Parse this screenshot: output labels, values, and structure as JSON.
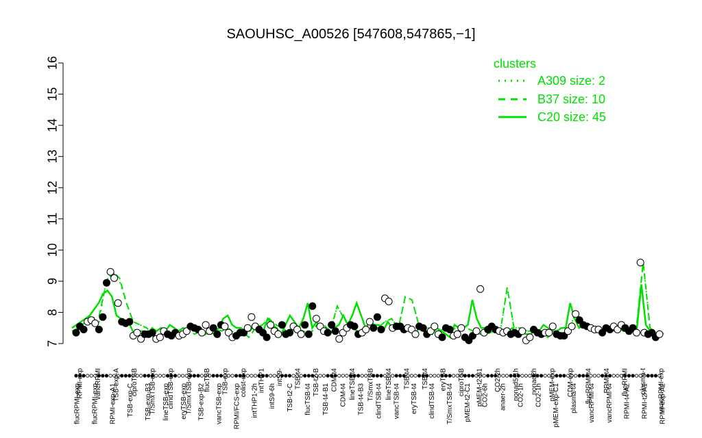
{
  "chart_data": {
    "type": "line",
    "title": "SAOUHSC_A00526 [547608,547865,−1]",
    "xlabel": "",
    "ylabel": "",
    "ylim": [
      7,
      16
    ],
    "yticks": [
      7,
      8,
      9,
      10,
      11,
      12,
      13,
      14,
      15,
      16
    ],
    "grid": false,
    "legend": {
      "title": "clusters",
      "position": "top-right",
      "entries": [
        {
          "label": "A309 size: 2",
          "style": "dotted"
        },
        {
          "label": "B37 size: 10",
          "style": "dashed"
        },
        {
          "label": "C20 size: 45",
          "style": "solid"
        }
      ]
    },
    "x_tick_labels": [
      "flucRPMI-exp",
      "flucRPMI-exp",
      "RPMI-exp-A1",
      "TSB-exp-C",
      "TSB-exp-B3",
      "lineTSB-exp",
      "eryTSB-exp",
      "TSB-exp-B2",
      "vancTSB-exp",
      "RPMI/FCS-exp",
      "intTHP1-2h",
      "intS9-6h",
      "TSB-t2-C",
      "flucTSB-t4",
      "TSB-t4-B1",
      "CDM-t4",
      "TSB-t4-B3",
      "clindTSB-t4",
      "vancTSB-t4",
      "eryTSB-t4",
      "clindTSB-t4",
      "T/SmxTSB-t4",
      "pMEM-t2-C1",
      "CO2-6h",
      "anaer-2h",
      "CO2-1h",
      "CO2-1h",
      "pMEM-exp-C1",
      "plasma-t4",
      "vancRPMI-t4",
      "vancRPMI-t4",
      "RPMI-t4-A2",
      "RPMI-t2-A1",
      "RPMI-exp-A2"
    ],
    "upper_labels": [
      "RPMI-exp",
      "vancRPMI",
      "TSB-exp-A",
      "ciproTSB",
      "T/SmxTSB-exp",
      "clindTSB-exp",
      "T/SmxTSB-exp",
      "flucTSB",
      "TSB-exp",
      "colist-exp",
      "intTHP1",
      "intS9-",
      "TSB-t4",
      "TSB-t2-B",
      "CDM-t4",
      "lineTSB-t4",
      "T/SmxTSB",
      "lineTSB-t4",
      "TSB-t4",
      "TSB-t4",
      "eryTSB",
      "ciproTSB",
      "pMEM-t2-B1",
      "CO2-2h",
      "nonad5-1h",
      "nonad2h",
      "pMEM-exp",
      "CDM-exp",
      "flucRPMI-t4",
      "RPMI-t4",
      "flucRPMI",
      "plasma-t",
      "vancRPMI-exp"
    ],
    "series": [
      {
        "style": "solid",
        "values": [
          7.5,
          7.6,
          7.7,
          7.8,
          7.9,
          8.1,
          8.3,
          8.6,
          8.7,
          8.5,
          7.9,
          7.8,
          7.7,
          7.6,
          7.3,
          7.4,
          7.4,
          7.3,
          7.5,
          7.4,
          7.5,
          7.4,
          7.6,
          7.5,
          7.4,
          7.5,
          7.4,
          7.6,
          7.5,
          7.5,
          7.3,
          7.4,
          7.3,
          7.5,
          7.8,
          7.9,
          7.6,
          7.5,
          7.5,
          7.4,
          7.4,
          7.6,
          7.5,
          7.4,
          7.8,
          7.6,
          7.5,
          7.3,
          7.6,
          7.9,
          7.7,
          7.5,
          7.8,
          8.3,
          7.5,
          7.7,
          7.4,
          7.5,
          7.3,
          7.5,
          7.6,
          7.9,
          7.6,
          7.9,
          8.3,
          7.9,
          7.5,
          7.7,
          7.6,
          7.6,
          7.4,
          7.7,
          7.5,
          7.5,
          7.6,
          7.4,
          7.5,
          7.3,
          7.5,
          7.4,
          7.4,
          7.3,
          7.5,
          7.4,
          7.3,
          7.2,
          7.6,
          7.5,
          7.5,
          7.6,
          8.4,
          7.8,
          7.5,
          7.5,
          7.6,
          7.5,
          7.4,
          7.4,
          7.4,
          7.5,
          7.3,
          7.4,
          7.3,
          7.3,
          7.4,
          7.4,
          7.6,
          7.5,
          7.4,
          7.4,
          7.5,
          7.5,
          8.3,
          7.8,
          7.5,
          7.6,
          7.5,
          7.5,
          7.4,
          7.4,
          7.5,
          7.5,
          7.4,
          7.5,
          7.4,
          7.4,
          7.5,
          7.5,
          8.9,
          7.6,
          7.4,
          7.3,
          7.4,
          7.3
        ]
      },
      {
        "style": "dashed",
        "values": [
          7.4,
          7.5,
          7.7,
          7.8,
          7.9,
          8.9,
          9.3,
          9.1,
          8.3,
          7.7,
          7.6,
          7.5,
          7.2,
          7.3,
          7.3,
          7.2,
          7.3,
          7.5,
          7.3,
          7.4,
          7.3,
          7.5,
          7.4,
          7.5,
          7.3,
          7.4,
          7.2,
          7.5,
          7.6,
          7.8,
          7.6,
          7.5,
          7.3,
          7.5,
          7.4,
          7.3,
          7.6,
          7.6,
          7.4,
          8.2,
          7.8,
          7.5,
          7.4,
          7.5,
          7.6,
          7.5,
          7.7,
          7.8,
          7.5,
          8.5,
          8.4,
          7.6,
          7.5,
          7.5,
          7.4,
          7.5,
          7.5,
          7.4,
          7.5,
          7.4,
          7.3,
          7.3,
          7.4,
          7.4,
          8.8,
          7.5,
          7.5,
          7.4,
          7.4,
          7.3,
          7.2,
          7.4,
          7.3,
          7.3,
          8.0,
          7.7,
          7.5,
          7.5,
          7.5,
          7.4,
          7.5,
          7.5,
          7.4,
          7.5,
          9.6,
          7.5,
          7.3,
          7.3
        ]
      },
      {
        "style": "dotted",
        "values": [
          7.4,
          7.5,
          7.8,
          7.8,
          7.7,
          9.0,
          9.3,
          9.0,
          8.3,
          7.7,
          7.6,
          7.5,
          7.2,
          7.3,
          7.3,
          7.2,
          7.3,
          7.5,
          7.3,
          7.4,
          7.3,
          7.5,
          7.4,
          7.5,
          7.3,
          7.4,
          7.2,
          7.5,
          7.6,
          7.8,
          7.6,
          7.5,
          7.3,
          7.5,
          7.4,
          7.3,
          7.6,
          7.6,
          7.4,
          8.2,
          7.8,
          7.5,
          7.4,
          7.5,
          7.6,
          7.5,
          7.7,
          7.8,
          7.5,
          8.5,
          8.4,
          7.6,
          7.5,
          7.5,
          7.4,
          7.5,
          7.5,
          7.4,
          7.5,
          7.4,
          7.3,
          7.3,
          7.4,
          7.4,
          8.8,
          7.5,
          7.5,
          7.4,
          7.4,
          7.3,
          7.2,
          7.4,
          7.3,
          7.3,
          8.0,
          7.7,
          7.5,
          7.5,
          7.5,
          7.4,
          7.5,
          7.5,
          7.4,
          7.5,
          9.6,
          7.5,
          7.3,
          7.3
        ]
      }
    ],
    "points": [
      7.35,
      7.55,
      7.45,
      7.7,
      7.75,
      7.65,
      7.45,
      7.85,
      8.95,
      9.3,
      9.1,
      8.3,
      7.7,
      7.65,
      7.7,
      7.25,
      7.35,
      7.15,
      7.3,
      7.3,
      7.35,
      7.15,
      7.2,
      7.4,
      7.3,
      7.25,
      7.35,
      7.25,
      7.3,
      7.4,
      7.55,
      7.5,
      7.45,
      7.35,
      7.6,
      7.4,
      7.5,
      7.3,
      7.6,
      7.55,
      7.35,
      7.2,
      7.25,
      7.35,
      7.35,
      7.5,
      7.85,
      7.55,
      7.45,
      7.35,
      7.2,
      7.6,
      7.4,
      7.3,
      7.6,
      7.3,
      7.35,
      7.55,
      7.45,
      7.3,
      7.6,
      7.3,
      8.2,
      7.8,
      7.55,
      7.4,
      7.35,
      7.6,
      7.4,
      7.15,
      7.35,
      7.5,
      7.6,
      7.55,
      7.3,
      7.35,
      7.45,
      7.7,
      7.5,
      7.85,
      7.45,
      8.45,
      8.35,
      7.5,
      7.55,
      7.55,
      7.45,
      7.5,
      7.45,
      7.3,
      7.55,
      7.5,
      7.3,
      7.4,
      7.55,
      7.3,
      7.2,
      7.5,
      7.45,
      7.25,
      7.3,
      7.5,
      7.2,
      7.1,
      7.25,
      7.4,
      8.75,
      7.35,
      7.45,
      7.55,
      7.45,
      7.4,
      7.35,
      7.4,
      7.3,
      7.35,
      7.3,
      7.4,
      7.1,
      7.2,
      7.45,
      7.35,
      7.3,
      7.35,
      7.35,
      7.55,
      7.3,
      7.25,
      7.25,
      7.4,
      7.55,
      7.95,
      7.75,
      7.6,
      7.55,
      7.5,
      7.45,
      7.45,
      7.35,
      7.5,
      7.45,
      7.55,
      7.45,
      7.6,
      7.5,
      7.4,
      7.5,
      7.35,
      9.6,
      7.35,
      7.3,
      7.35,
      7.2,
      7.3
    ],
    "strip_colors": [
      "#000000",
      "#ffffff"
    ]
  }
}
